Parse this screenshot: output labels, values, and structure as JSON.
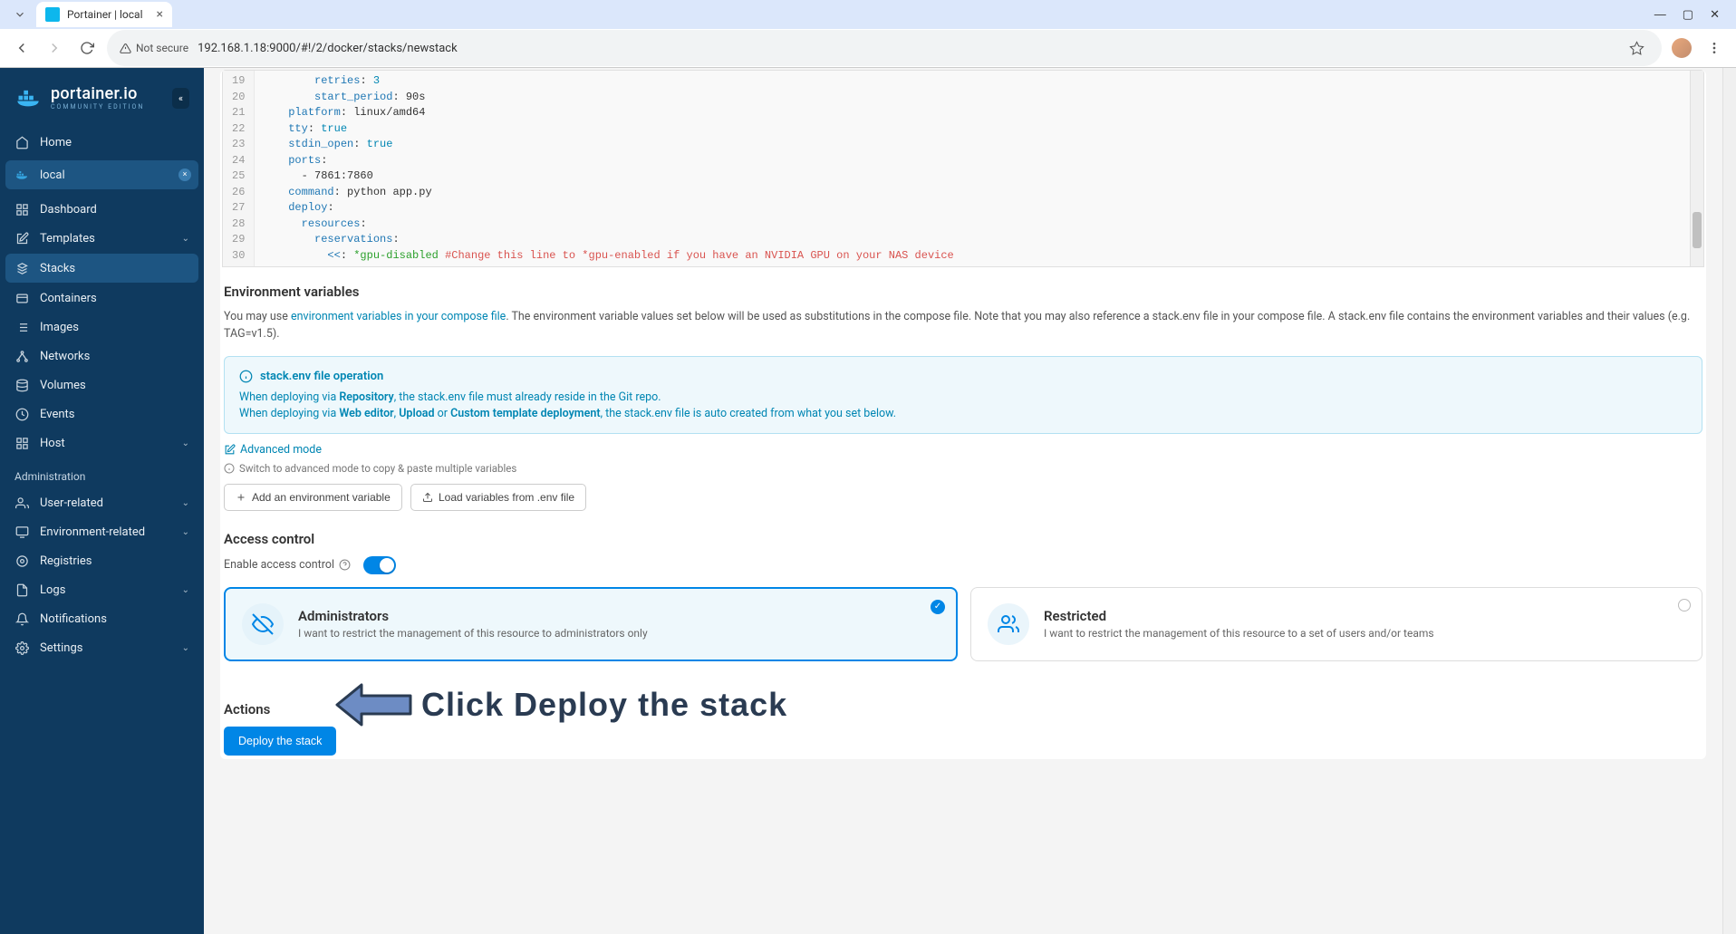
{
  "browser": {
    "tab_title": "Portainer | local",
    "url": "192.168.1.18:9000/#!/2/docker/stacks/newstack",
    "not_secure": "Not secure"
  },
  "logo": {
    "name": "portainer.io",
    "edition": "COMMUNITY EDITION"
  },
  "nav": {
    "home": "Home",
    "env_name": "local",
    "items": [
      "Dashboard",
      "Templates",
      "Stacks",
      "Containers",
      "Images",
      "Networks",
      "Volumes",
      "Events",
      "Host"
    ],
    "admin_label": "Administration",
    "admin_items": [
      "User-related",
      "Environment-related",
      "Registries",
      "Logs",
      "Notifications",
      "Settings"
    ]
  },
  "code": {
    "lines": [
      {
        "n": 19,
        "indent": 8,
        "key": "retries",
        "val": "3",
        "val_cls": "tok-num"
      },
      {
        "n": 20,
        "indent": 8,
        "key": "start_period",
        "val": "90s"
      },
      {
        "n": 21,
        "indent": 4,
        "key": "platform",
        "val": "linux/amd64"
      },
      {
        "n": 22,
        "indent": 4,
        "key": "tty",
        "val": "true",
        "val_cls": "tok-bool"
      },
      {
        "n": 23,
        "indent": 4,
        "key": "stdin_open",
        "val": "true",
        "val_cls": "tok-bool"
      },
      {
        "n": 24,
        "indent": 4,
        "key": "ports",
        "val": ""
      },
      {
        "n": 25,
        "indent": 6,
        "raw": "- 7861:7860"
      },
      {
        "n": 26,
        "indent": 4,
        "key": "command",
        "val": "python app.py"
      },
      {
        "n": 27,
        "indent": 4,
        "key": "deploy",
        "val": ""
      },
      {
        "n": 28,
        "indent": 6,
        "key": "resources",
        "val": ""
      },
      {
        "n": 29,
        "indent": 8,
        "key": "reservations",
        "val": ""
      },
      {
        "n": 30,
        "indent": 10,
        "merge": "<<",
        "alias": "*gpu-disabled",
        "comment": "#Change this line to *gpu-enabled if you have an NVIDIA GPU on your NAS device"
      }
    ]
  },
  "env": {
    "title": "Environment variables",
    "help_prefix": "You may use ",
    "help_link": "environment variables in your compose file",
    "help_suffix": ". The environment variable values set below will be used as substitutions in the compose file. Note that you may also reference a stack.env file in your compose file. A stack.env file contains the environment variables and their values (e.g. TAG=v1.5).",
    "info_title": "stack.env file operation",
    "info_l1a": "When deploying via ",
    "info_l1b": "Repository",
    "info_l1c": ", the stack.env file must already reside in the Git repo.",
    "info_l2a": "When deploying via ",
    "info_l2b": "Web editor",
    "info_l2c": ", ",
    "info_l2d": "Upload",
    "info_l2e": " or ",
    "info_l2f": "Custom template deployment",
    "info_l2g": ", the stack.env file is auto created from what you set below.",
    "advanced": "Advanced mode",
    "hint": "Switch to advanced mode to copy & paste multiple variables",
    "btn_add": "Add an environment variable",
    "btn_load": "Load variables from .env file"
  },
  "access": {
    "title": "Access control",
    "label": "Enable access control",
    "opt1_title": "Administrators",
    "opt1_desc": "I want to restrict the management of this resource to administrators only",
    "opt2_title": "Restricted",
    "opt2_desc": "I want to restrict the management of this resource to a set of users and/or teams"
  },
  "actions": {
    "title": "Actions",
    "deploy": "Deploy the stack",
    "annotation": "Click Deploy the stack"
  }
}
